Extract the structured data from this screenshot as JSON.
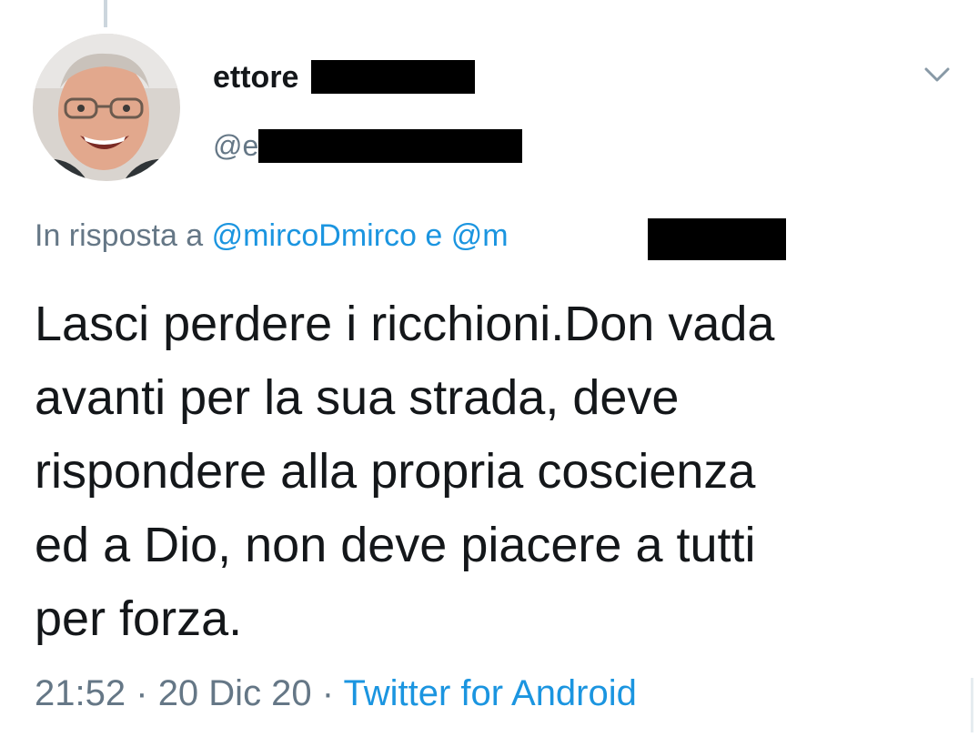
{
  "tweet": {
    "author": {
      "display_name_visible": "ettore",
      "handle_visible": "@e",
      "avatar_icon": "profile-photo-icon"
    },
    "menu_icon": "chevron-down-icon",
    "reply": {
      "prefix": "In risposta a",
      "mention_1": "@mircoDmirco",
      "joiner": "e",
      "mention_2_visible": "@m"
    },
    "text": "Lasci perdere i ricchioni.Don vada\navanti per la sua strada, deve\nrispondere alla propria coscienza\ned a Dio,  non deve piacere a tutti\nper forza.",
    "meta": {
      "time": "21:52",
      "dot_1": "·",
      "date": "20 Dic 20",
      "dot_2": "·",
      "source": "Twitter for Android"
    },
    "colors": {
      "text": "#14171a",
      "secondary": "#657786",
      "link": "#1b95e0",
      "redaction": "#000000"
    }
  }
}
